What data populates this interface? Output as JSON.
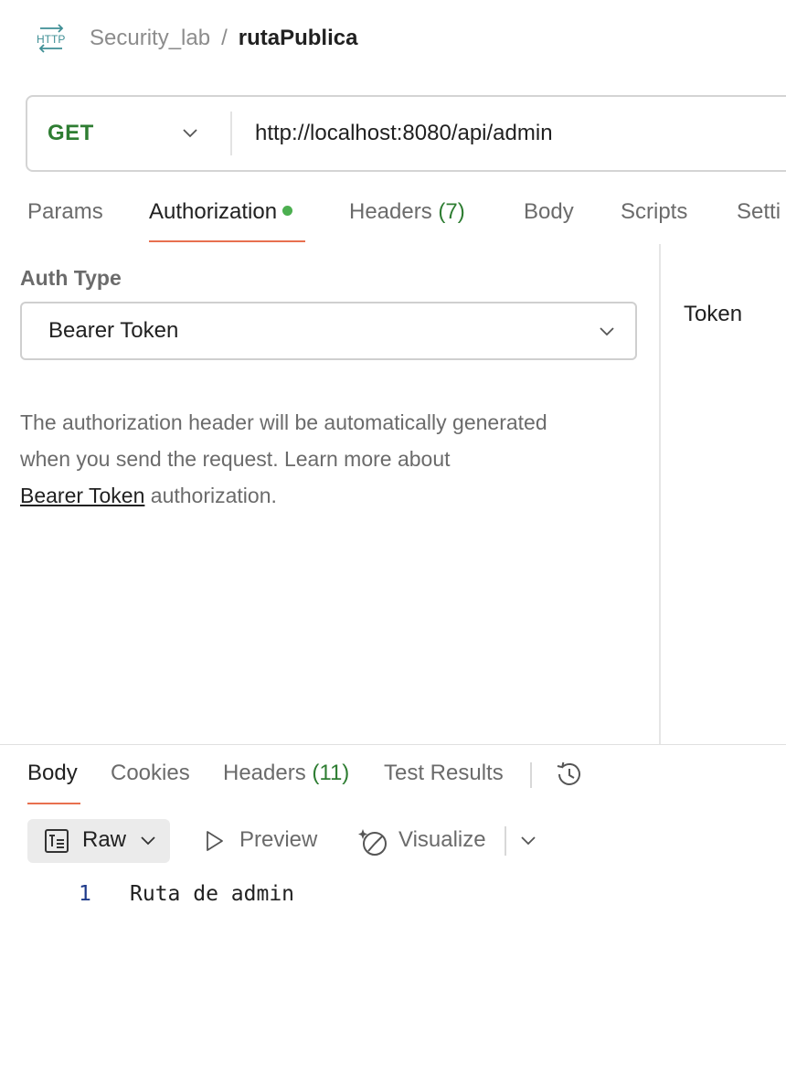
{
  "breadcrumb": {
    "icon": "http-icon",
    "parent": "Security_lab",
    "separator": "/",
    "current": "rutaPublica"
  },
  "request": {
    "method": "GET",
    "url": "http://localhost:8080/api/admin"
  },
  "request_tabs": {
    "params": "Params",
    "authorization": "Authorization",
    "headers": "Headers",
    "headers_count": "(7)",
    "body": "Body",
    "scripts": "Scripts",
    "settings": "Setti",
    "active": "Authorization"
  },
  "auth": {
    "label": "Auth Type",
    "type": "Bearer Token",
    "description_line1": "The authorization header will be automatically generated",
    "description_line2": "when you send the request. Learn more about",
    "link_text": "Bearer Token",
    "description_tail": " authorization.",
    "token_label": "Token"
  },
  "response_tabs": {
    "body": "Body",
    "cookies": "Cookies",
    "headers": "Headers",
    "headers_count": "(11)",
    "test_results": "Test Results",
    "active": "Body"
  },
  "format_bar": {
    "raw": "Raw",
    "preview": "Preview",
    "visualize": "Visualize"
  },
  "response_body": {
    "lines": [
      {
        "number": "1",
        "text": "Ruta de admin"
      }
    ]
  },
  "colors": {
    "method_green": "#2e7d32",
    "tab_accent": "#e8704f",
    "dot_green": "#4caf50",
    "line_number": "#1e3a8a"
  }
}
